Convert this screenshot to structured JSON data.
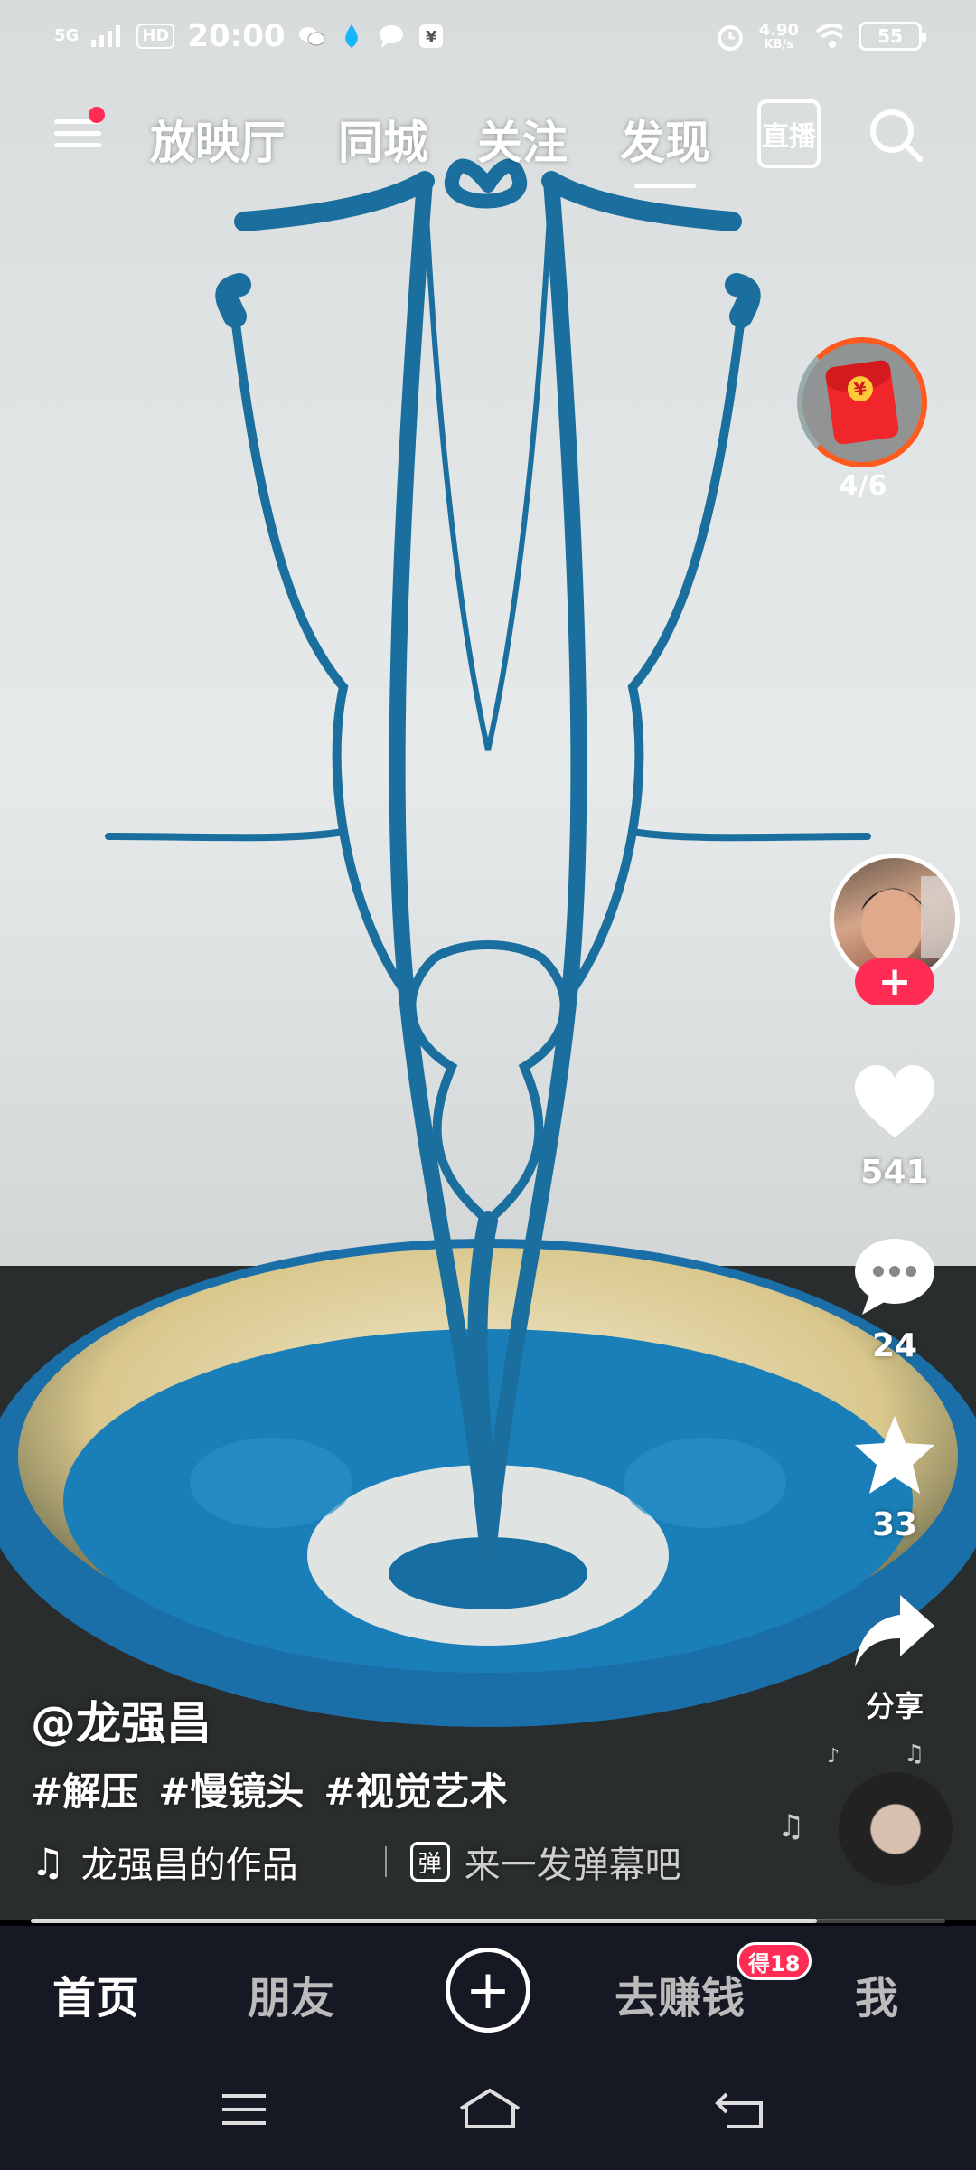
{
  "status_bar": {
    "network": "5G",
    "hd": "HD",
    "time": "20:00",
    "speed_value": "4.90",
    "speed_unit": "KB/s",
    "battery": "55",
    "icons": [
      "signal-icon",
      "wechat-icon",
      "droplet-icon",
      "chat-bubble-icon",
      "payment-icon",
      "alarm-icon",
      "wifi-icon",
      "battery-icon"
    ]
  },
  "top_nav": {
    "tabs": [
      "放映厅",
      "同城",
      "关注",
      "发现"
    ],
    "active_tab": "发现",
    "live_label": "直播"
  },
  "red_packet": {
    "progress": "4/6"
  },
  "actions": {
    "likes": "541",
    "comments": "24",
    "favorites": "33",
    "share_label": "分享"
  },
  "caption": {
    "author": "@龙强昌",
    "tags": [
      "#解压",
      "#慢镜头",
      "#视觉艺术"
    ],
    "music": "龙强昌的作品",
    "danmu_icon": "弹",
    "danmu_hint": "来一发弹幕吧"
  },
  "playback": {
    "progress_fraction": 0.86
  },
  "bottom_nav": {
    "items": [
      "首页",
      "朋友",
      "去赚钱",
      "我"
    ],
    "active": "首页",
    "earn_badge": "得18"
  },
  "colors": {
    "accent": "#ff2d55",
    "nav_bg": "#161823",
    "liquid_blue": "#1a7fb8"
  }
}
